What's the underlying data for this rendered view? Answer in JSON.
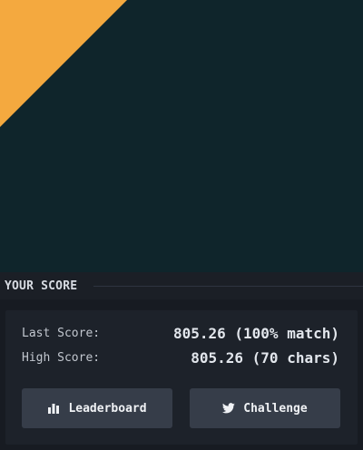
{
  "preview": {
    "background": "#0f252b",
    "shape_color": "#f4a93f"
  },
  "score": {
    "header": "YOUR SCORE",
    "last_label": "Last Score:",
    "last_value": "805.26 (100% match)",
    "high_label": "High Score:",
    "high_value": "805.26 (70 chars)"
  },
  "buttons": {
    "leaderboard": {
      "label": "Leaderboard",
      "icon": "bar-chart-icon"
    },
    "challenge": {
      "label": "Challenge",
      "icon": "twitter-icon"
    }
  }
}
